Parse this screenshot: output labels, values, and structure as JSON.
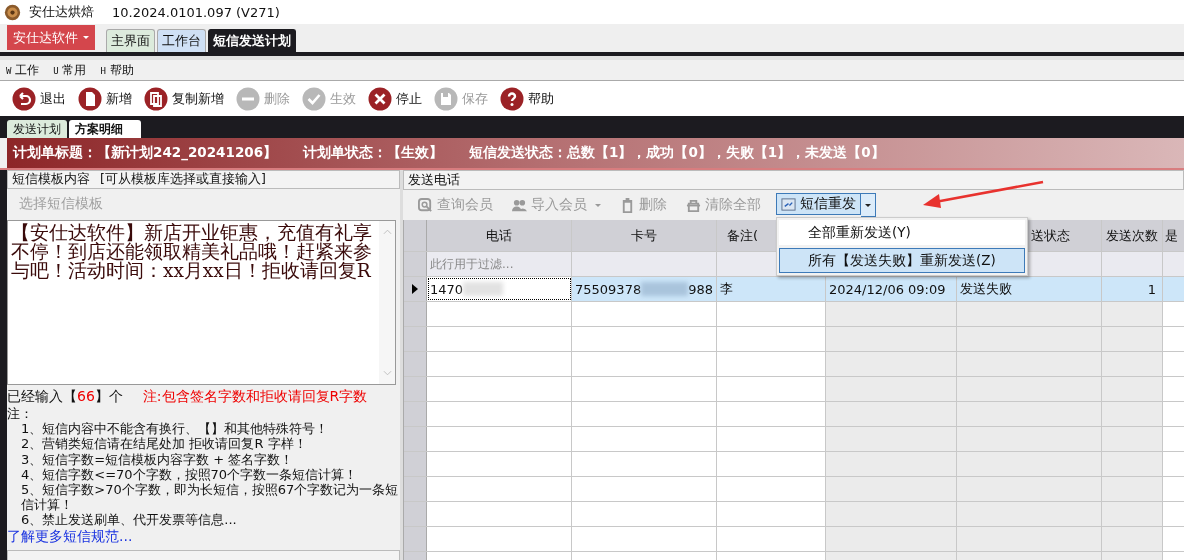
{
  "window": {
    "app_name": "安仕达烘焙",
    "version": "10.2024.0101.097 (V271)"
  },
  "app_menu": {
    "label": "安仕达软件"
  },
  "main_tabs": [
    {
      "label": "主界面",
      "selected": false,
      "color": "#dcebdc"
    },
    {
      "label": "工作台",
      "selected": false,
      "color": "#cfe0f5"
    },
    {
      "label": "短信发送计划",
      "selected": true,
      "color": "#1c1b20"
    }
  ],
  "menu": [
    {
      "key": "W",
      "label": "工作"
    },
    {
      "key": "U",
      "label": "常用"
    },
    {
      "key": "H",
      "label": "帮助"
    }
  ],
  "toolbar": [
    {
      "kind": "exit",
      "label": "退出",
      "disabled": false
    },
    {
      "kind": "new",
      "label": "新增",
      "disabled": false
    },
    {
      "kind": "copy",
      "label": "复制新增",
      "disabled": false
    },
    {
      "kind": "delete",
      "label": "删除",
      "disabled": true
    },
    {
      "kind": "apply",
      "label": "生效",
      "disabled": true
    },
    {
      "kind": "stop",
      "label": "停止",
      "disabled": false
    },
    {
      "kind": "save",
      "label": "保存",
      "disabled": true
    },
    {
      "kind": "help",
      "label": "帮助",
      "disabled": false
    }
  ],
  "sub_tabs": [
    {
      "label": "发送计划",
      "selected": false
    },
    {
      "label": "方案明细",
      "selected": true
    }
  ],
  "status_bar": {
    "title": "计划单标题：【新计划242_20241206】",
    "plan_status": "计划单状态：【生效】",
    "send_status": "短信发送状态：总数【1】，成功【0】，失败【1】，未发送【0】"
  },
  "template_panel": {
    "header": "短信模板内容",
    "hint": "[可从模板库选择或直接输入]",
    "template_button": {
      "label": "选择短信模板",
      "disabled": true
    },
    "message": "【安仕达软件】新店开业钜惠，充值有礼享不停！到店还能领取精美礼品哦！赶紧来参与吧！活动时间：xx月xx日！拒收请回复R",
    "count_prefix": "已经输入【",
    "count": "66",
    "count_suffix": "】个",
    "count_note": "注:包含签名字数和拒收请回复R字数",
    "notes_title": "注：",
    "notes": [
      "1、短信内容中不能含有换行、【】和其他特殊符号！",
      "2、营销类短信请在结尾处加 拒收请回复R 字样！",
      "3、短信字数=短信模板内容字数 + 签名字数！",
      "4、短信字数<=70个字数，按照70个字数一条短信计算！",
      "5、短信字数>70个字数，即为长短信，按照67个字数记为一条短信计算！",
      "6、禁止发送刷单、代开发票等信息..."
    ],
    "link": "了解更多短信规范..."
  },
  "phone_panel": {
    "header": "发送电话",
    "toolbar": [
      {
        "kind": "search",
        "label": "查询会员",
        "disabled": true,
        "has_dropdown": false
      },
      {
        "kind": "import",
        "label": "导入会员",
        "disabled": true,
        "has_dropdown": true
      },
      {
        "kind": "delete",
        "label": "删除",
        "disabled": true,
        "has_dropdown": false
      },
      {
        "kind": "clear",
        "label": "清除全部",
        "disabled": true,
        "has_dropdown": false
      }
    ],
    "resend_button": {
      "label": "短信重发",
      "expanded": true
    },
    "resend_menu": [
      {
        "label": "全部重新发送(Y)",
        "selected": false
      },
      {
        "label": "所有【发送失败】重新发送(Z)",
        "selected": true
      }
    ],
    "columns": [
      "电话",
      "卡号",
      "备注(",
      "送状态",
      "发送次数",
      "是"
    ],
    "filter_placeholder": "此行用于过滤...",
    "rows": [
      {
        "selected": true,
        "phone": "1470",
        "card_start": "75509378",
        "card_end": "988",
        "note": "李",
        "time": "2024/12/06 09:09",
        "status": "发送失败",
        "count": "1"
      }
    ]
  }
}
